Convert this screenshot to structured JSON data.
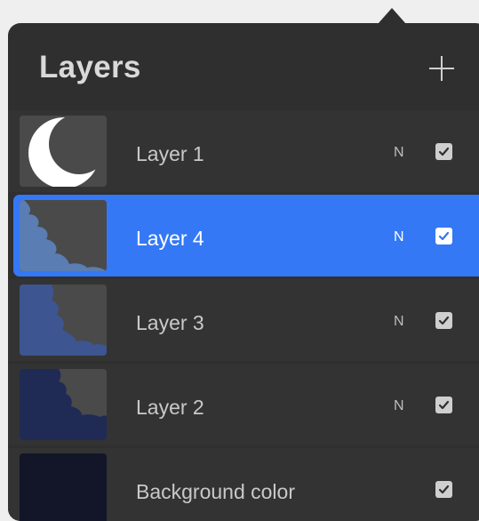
{
  "panel": {
    "title": "Layers",
    "add_icon": "plus-icon"
  },
  "layers": [
    {
      "name": "Layer 1",
      "blend": "N",
      "visible": true,
      "selected": false,
      "thumbnail": "moon"
    },
    {
      "name": "Layer 4",
      "blend": "N",
      "visible": true,
      "selected": true,
      "thumbnail": "cloud-light"
    },
    {
      "name": "Layer 3",
      "blend": "N",
      "visible": true,
      "selected": false,
      "thumbnail": "cloud-mid"
    },
    {
      "name": "Layer 2",
      "blend": "N",
      "visible": true,
      "selected": false,
      "thumbnail": "cloud-dark"
    },
    {
      "name": "Background color",
      "blend": "",
      "visible": true,
      "selected": false,
      "thumbnail": "solid"
    }
  ],
  "colors": {
    "panel_bg": "#2f2f2f",
    "selected_row": "#3478f6",
    "moon": "#ffffff",
    "cloud_light": "#5a7db3",
    "cloud_mid": "#3d5590",
    "cloud_dark": "#1f2a55",
    "background_color": "#121628"
  }
}
